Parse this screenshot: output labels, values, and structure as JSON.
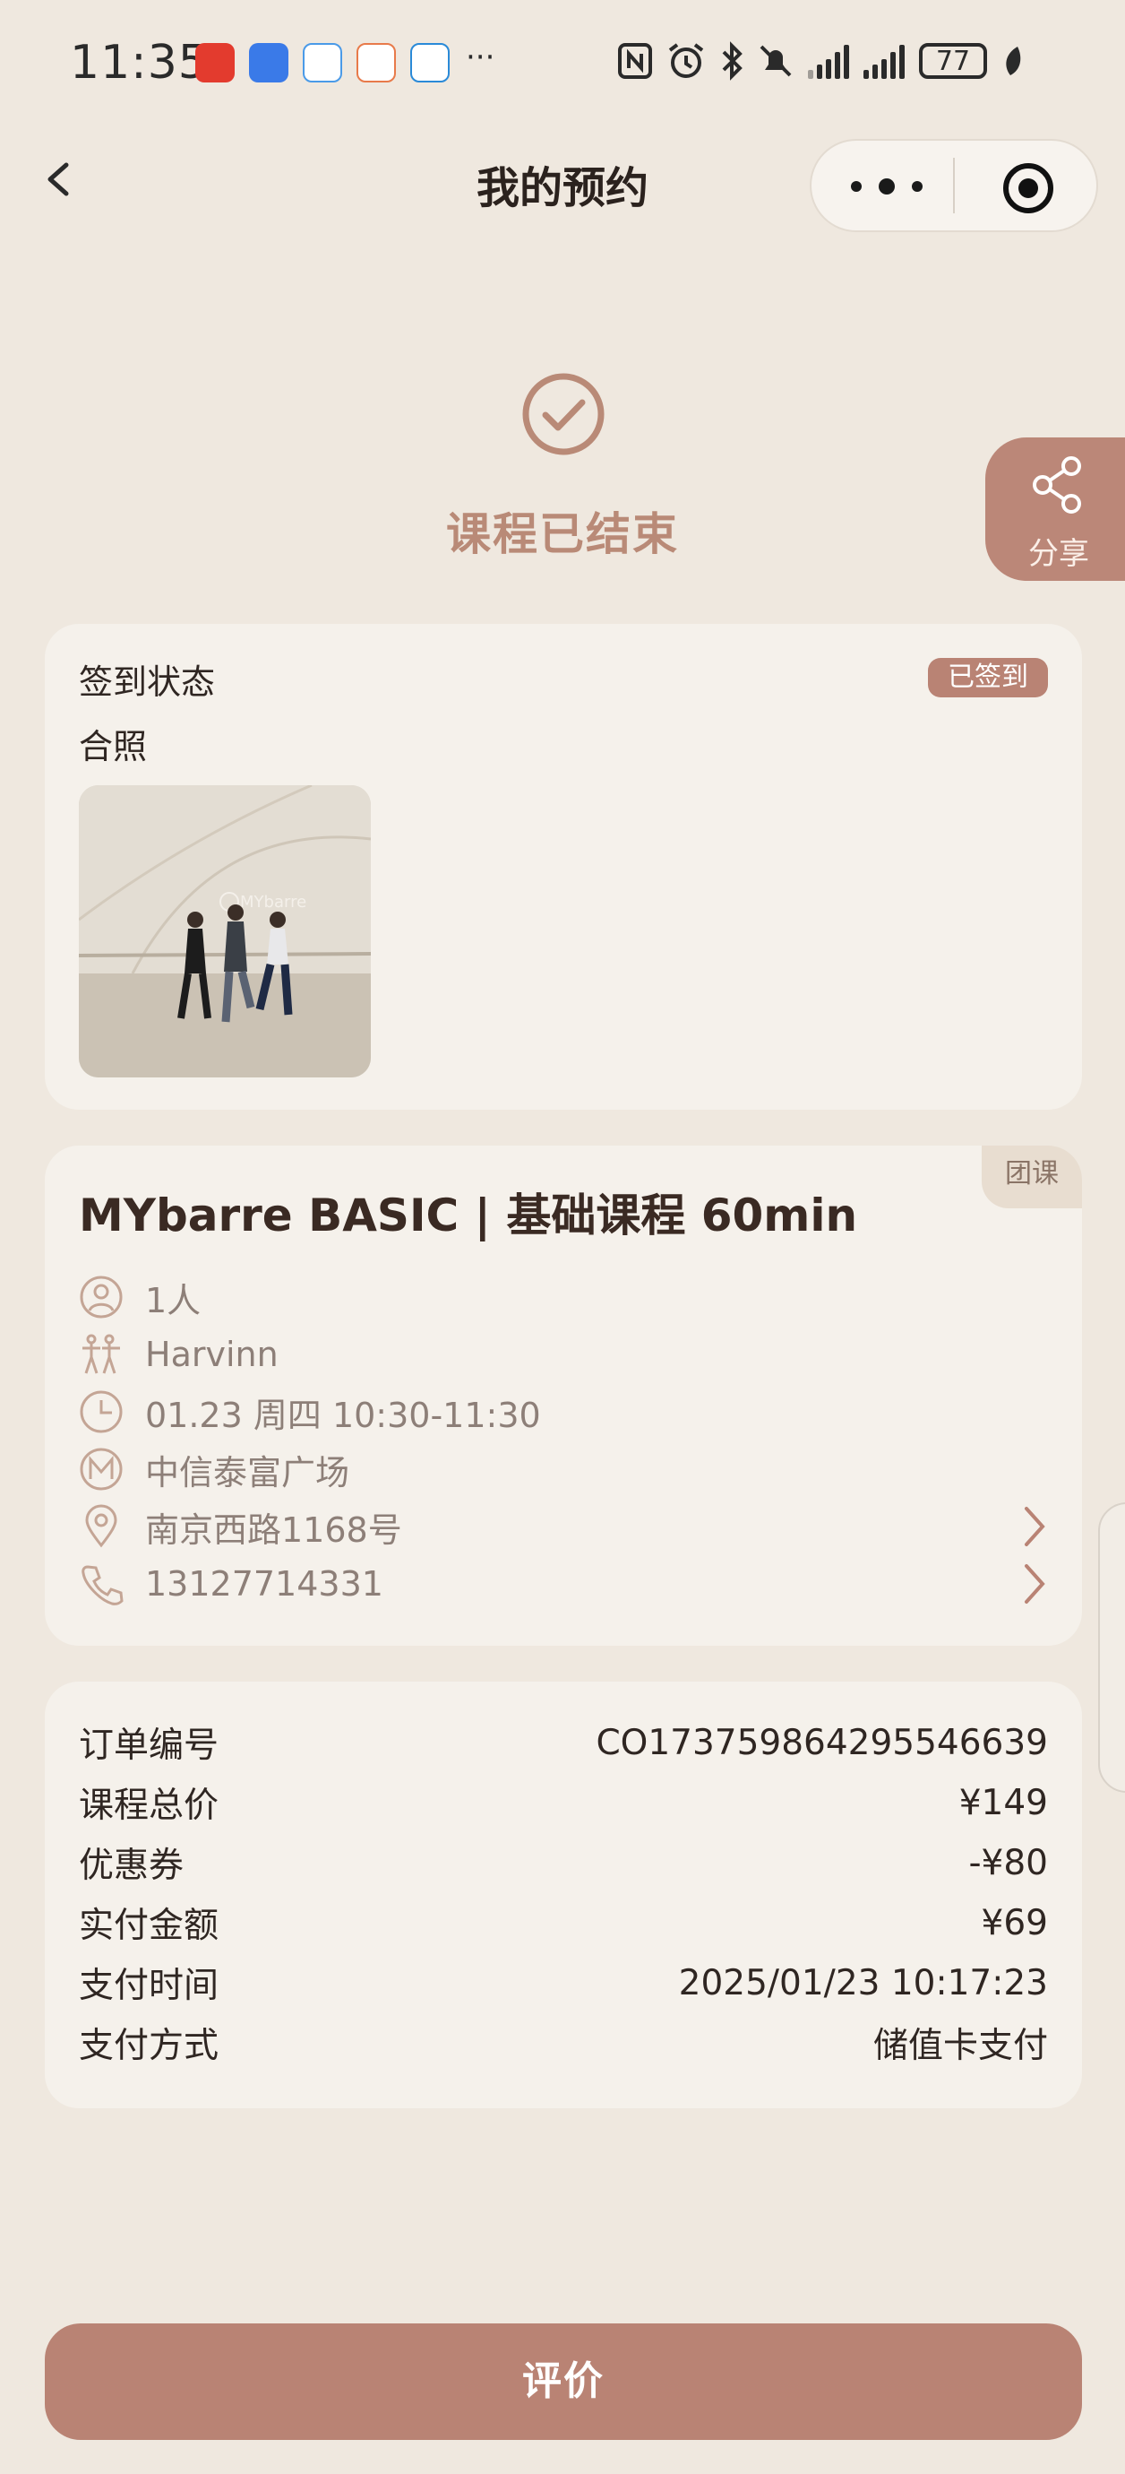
{
  "status_bar": {
    "time": "11:35",
    "more": "···",
    "battery": "77",
    "icons": [
      "nfc-icon",
      "alarm-icon",
      "bluetooth-icon",
      "mute-icon",
      "signal-icon",
      "signal-icon",
      "battery-icon",
      "leaf-icon"
    ]
  },
  "nav": {
    "title": "我的预约",
    "back_icon": "chevron-left-icon",
    "more_icon": "more-dots-icon",
    "record_icon": "target-icon"
  },
  "result": {
    "text": "课程已结束",
    "icon": "check-circle-icon"
  },
  "share": {
    "label": "分享",
    "icon": "share-icon"
  },
  "checkin": {
    "title": "签到状态",
    "status": "已签到",
    "photo_label": "合照"
  },
  "course": {
    "tag": "团课",
    "title": "MYbarre BASIC | 基础课程 60min",
    "people": "1人",
    "coach": "Harvinn",
    "time": "01.23 周四 10:30-11:30",
    "venue": "中信泰富广场",
    "address": "南京西路1168号",
    "phone": "13127714331"
  },
  "order": {
    "rows": [
      {
        "label": "订单编号",
        "value": "CO17375986429554663​9"
      },
      {
        "label": "课程总价",
        "value": "¥149"
      },
      {
        "label": "优惠券",
        "value": "-¥80"
      },
      {
        "label": "实付金额",
        "value": "¥69"
      },
      {
        "label": "支付时间",
        "value": "2025/01/23 10:17:23"
      },
      {
        "label": "支付方式",
        "value": "储值卡支付"
      }
    ]
  },
  "action": {
    "review": "评价"
  },
  "colors": {
    "background": "#efe8df",
    "accent": "#b98374",
    "card": "#f5f1eb",
    "muted_text": "#8d7f78"
  }
}
